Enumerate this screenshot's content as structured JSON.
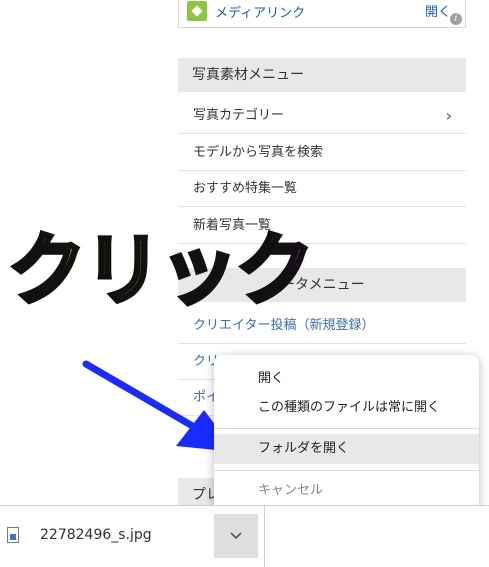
{
  "ad": {
    "text": "メディアリンク",
    "open_label": "開く",
    "info_icon": "i"
  },
  "photo_menu": {
    "title": "写真素材メニュー",
    "items": [
      {
        "label": "写真カテゴリー",
        "chevron": "›"
      },
      {
        "label": "モデルから写真を検索"
      },
      {
        "label": "おすすめ特集一覧"
      },
      {
        "label": "新着写真一覧"
      }
    ]
  },
  "creator_menu": {
    "title": "ータメニュー",
    "items": [
      {
        "label": "クリエイター投稿（新規登録）"
      },
      {
        "label": "クリ"
      },
      {
        "label": "ポイ"
      }
    ]
  },
  "partial_section": {
    "title": "プレ"
  },
  "overlay": {
    "text": "クリック",
    "arrow_color": "#1a2bff"
  },
  "context_menu": {
    "items": [
      {
        "label": "開く"
      },
      {
        "label": "この種類のファイルは常に開く"
      },
      {
        "label": "フォルダを開く",
        "highlighted": true
      },
      {
        "label": "キャンセル"
      }
    ]
  },
  "download_bar": {
    "file_name": "22782496_s.jpg",
    "file_icon": "image-file-icon",
    "chevron_icon": "chevron-down-icon"
  }
}
